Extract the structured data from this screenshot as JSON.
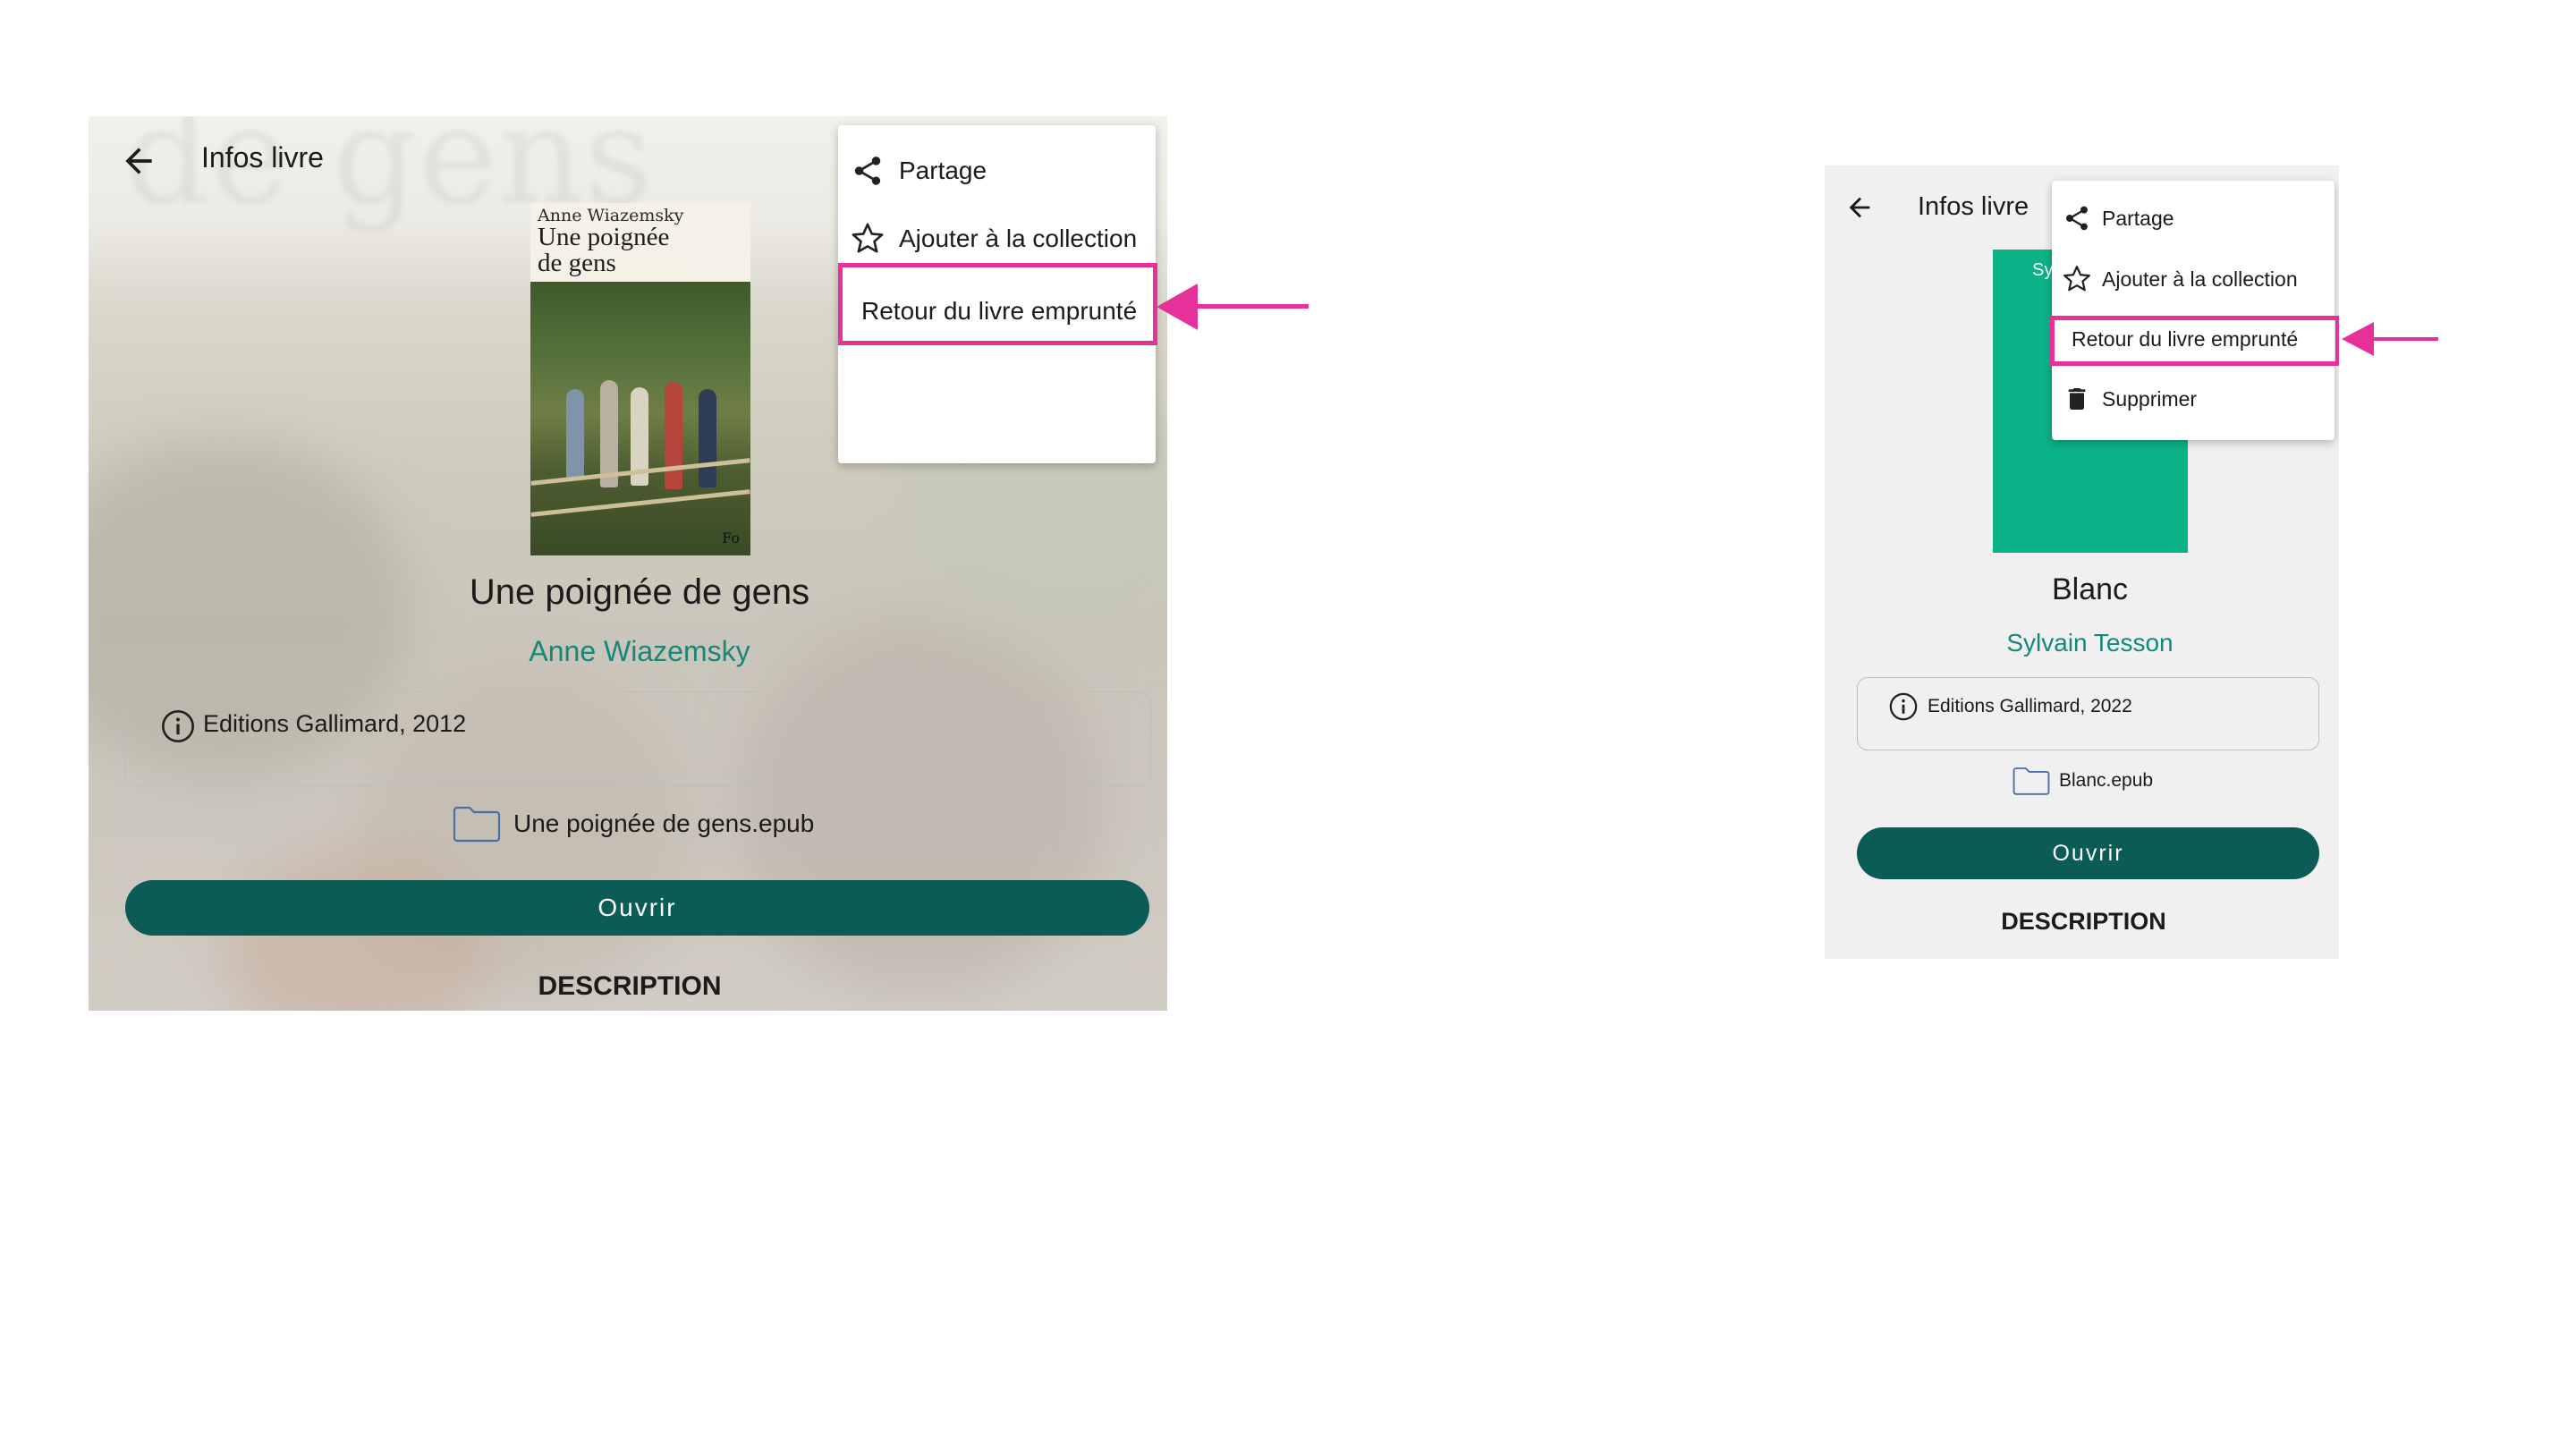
{
  "left_screen": {
    "toolbar": {
      "title": "Infos livre",
      "back_icon": "arrow-left-icon"
    },
    "cover": {
      "author_text": "Anne Wiazemsky",
      "title_text": "Une poignée de gens",
      "publisher_mark": "Fo"
    },
    "book": {
      "title": "Une poignée de gens",
      "author": "Anne Wiazemsky"
    },
    "info": {
      "icon": "info-icon",
      "text": "Editions Gallimard, 2012"
    },
    "file": {
      "icon": "folder-icon",
      "name": "Une poignée de gens.epub"
    },
    "open_button": "Ouvrir",
    "description_label": "DESCRIPTION",
    "menu": {
      "items": [
        {
          "icon": "share-icon",
          "label": "Partage"
        },
        {
          "icon": "star-outline-icon",
          "label": "Ajouter à la collection"
        },
        {
          "icon": "",
          "label": "Retour du livre emprunté"
        }
      ],
      "highlighted_index": 2
    }
  },
  "right_screen": {
    "toolbar": {
      "title": "Infos livre",
      "back_icon": "arrow-left-icon"
    },
    "cover": {
      "color": "#0cb287",
      "partial_text": "Sy"
    },
    "book": {
      "title": "Blanc",
      "author": "Sylvain Tesson"
    },
    "info": {
      "icon": "info-icon",
      "text": "Editions Gallimard, 2022"
    },
    "file": {
      "icon": "folder-icon",
      "name": "Blanc.epub"
    },
    "open_button": "Ouvrir",
    "description_label": "DESCRIPTION",
    "menu": {
      "items": [
        {
          "icon": "share-icon",
          "label": "Partage"
        },
        {
          "icon": "star-outline-icon",
          "label": "Ajouter à la collection"
        },
        {
          "icon": "",
          "label": "Retour du livre emprunté"
        },
        {
          "icon": "trash-icon",
          "label": "Supprimer"
        }
      ],
      "highlighted_index": 2
    }
  },
  "colors": {
    "accent_teal": "#16877a",
    "button_dark_teal": "#0b5c56",
    "highlight_pink": "#e6319b",
    "cover_green": "#0cb287"
  }
}
